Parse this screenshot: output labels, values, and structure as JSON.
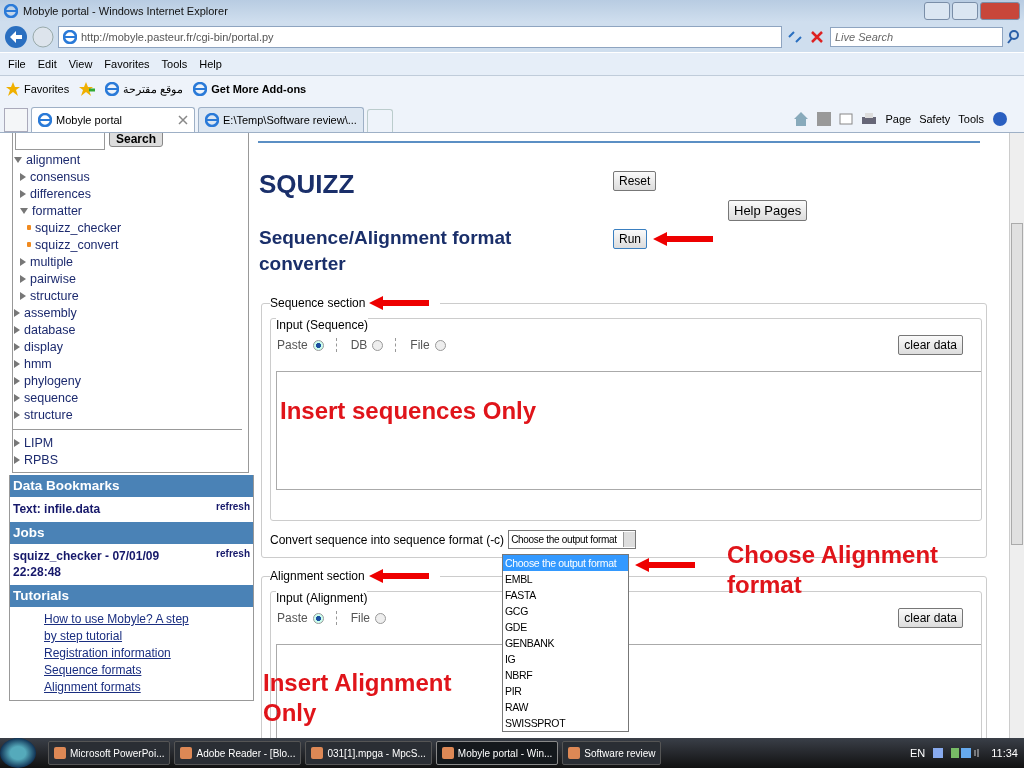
{
  "window": {
    "title": "Mobyle portal - Windows Internet Explorer"
  },
  "address_bar": {
    "url": "http://mobyle.pasteur.fr/cgi-bin/portal.py",
    "search_placeholder": "Live Search"
  },
  "menu": [
    "File",
    "Edit",
    "View",
    "Favorites",
    "Tools",
    "Help"
  ],
  "favorites_bar": {
    "favorites": "Favorites",
    "links": [
      "موقع مقترحة",
      "Get More Add-ons"
    ]
  },
  "tabs": [
    {
      "label": "Mobyle portal",
      "selected": true
    },
    {
      "label": "E:\\Temp\\Software review\\...",
      "selected": false
    }
  ],
  "command_bar": [
    "Page",
    "Safety",
    "Tools"
  ],
  "sidebar": {
    "search_button": "Search",
    "tree": [
      {
        "label": "alignment",
        "expanded": true,
        "children": [
          {
            "label": "consensus",
            "expanded": false
          },
          {
            "label": "differences",
            "expanded": false
          },
          {
            "label": "formatter",
            "expanded": true,
            "children": [
              {
                "label": "squizz_checker",
                "kind": "program"
              },
              {
                "label": "squizz_convert",
                "kind": "program"
              }
            ]
          },
          {
            "label": "multiple",
            "expanded": false
          },
          {
            "label": "pairwise",
            "expanded": false
          },
          {
            "label": "structure",
            "expanded": false
          }
        ]
      },
      {
        "label": "assembly",
        "expanded": false
      },
      {
        "label": "database",
        "expanded": false
      },
      {
        "label": "display",
        "expanded": false
      },
      {
        "label": "hmm",
        "expanded": false
      },
      {
        "label": "phylogeny",
        "expanded": false
      },
      {
        "label": "sequence",
        "expanded": false
      },
      {
        "label": "structure",
        "expanded": false
      }
    ],
    "servers": [
      {
        "label": "LIPM",
        "expanded": false
      },
      {
        "label": "RPBS",
        "expanded": false
      }
    ],
    "data_bookmarks": {
      "title": "Data Bookmarks",
      "item": "Text: infile.data",
      "refresh": "refresh"
    },
    "jobs": {
      "title": "Jobs",
      "item": "squizz_checker - 07/01/09 22:28:48",
      "refresh": "refresh"
    },
    "tutorials": {
      "title": "Tutorials",
      "links": [
        "How to use Mobyle? A step by step tutorial",
        "Registration information",
        "Sequence formats",
        "Alignment formats"
      ]
    }
  },
  "main": {
    "title": "SQUIZZ",
    "subtitle": "Sequence/Alignment format converter",
    "reset": "Reset",
    "help": "Help Pages",
    "run": "Run",
    "sequence_section": {
      "legend": "Sequence section",
      "input_legend": "Input (Sequence)",
      "sources": [
        {
          "label": "Paste",
          "selected": true
        },
        {
          "label": "DB",
          "selected": false
        },
        {
          "label": "File",
          "selected": false
        }
      ],
      "clear": "clear data",
      "convert_label": "Convert sequence into sequence format (-c)",
      "select_value": "Choose the output format"
    },
    "dropdown": [
      {
        "label": "Choose the output format",
        "selected": true
      },
      {
        "label": "EMBL",
        "selected": false
      },
      {
        "label": "FASTA",
        "selected": false
      },
      {
        "label": "GCG",
        "selected": false
      },
      {
        "label": "GDE",
        "selected": false
      },
      {
        "label": "GENBANK",
        "selected": false
      },
      {
        "label": "IG",
        "selected": false
      },
      {
        "label": "NBRF",
        "selected": false
      },
      {
        "label": "PIR",
        "selected": false
      },
      {
        "label": "RAW",
        "selected": false
      },
      {
        "label": "SWISSPROT",
        "selected": false
      }
    ],
    "alignment_section": {
      "legend": "Alignment section",
      "input_legend": "Input (Alignment)",
      "sources": [
        {
          "label": "Paste",
          "selected": true
        },
        {
          "label": "File",
          "selected": false
        }
      ],
      "clear": "clear data"
    }
  },
  "annotations": [
    "Insert sequences Only",
    "Choose Alignment format",
    "Insert Alignment Only"
  ],
  "taskbar": {
    "items": [
      {
        "label": "Microsoft PowerPoi...",
        "selected": false
      },
      {
        "label": "Adobe Reader - [Blo...",
        "selected": false
      },
      {
        "label": "031[1].mpga - MpcS...",
        "selected": false
      },
      {
        "label": "Mobyle portal - Win...",
        "selected": true
      },
      {
        "label": "Software review",
        "selected": false
      }
    ],
    "language": "EN",
    "clock": "11:34"
  }
}
